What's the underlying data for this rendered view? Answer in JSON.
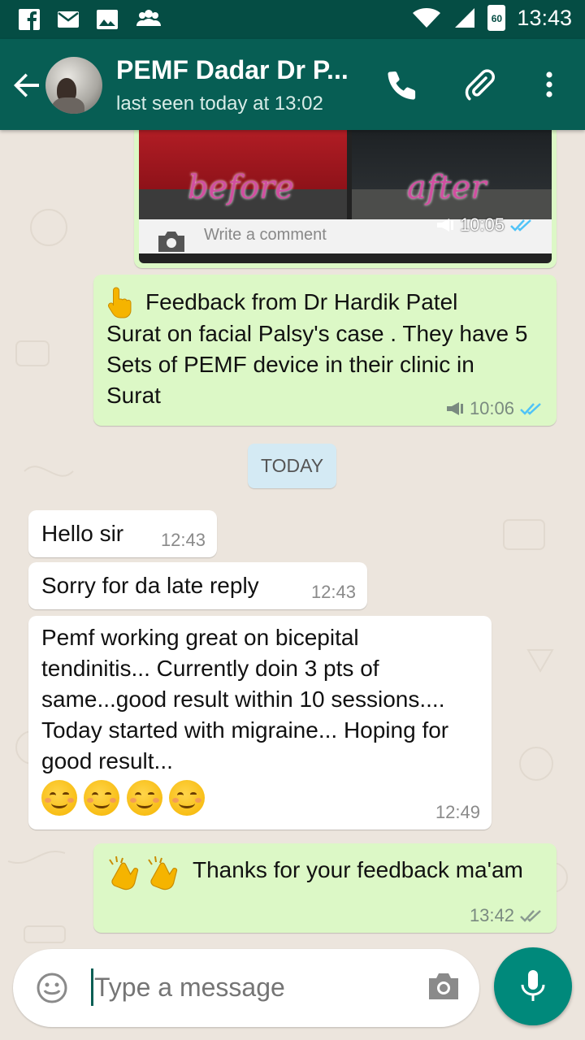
{
  "status_bar": {
    "time": "13:43",
    "battery_level": "60",
    "icons": [
      "facebook-icon",
      "mail-icon",
      "image-icon",
      "people-icon",
      "wifi-icon",
      "signal-icon",
      "battery-icon"
    ]
  },
  "header": {
    "contact_name": "PEMF Dadar Dr P...",
    "status": "last seen today at 13:02",
    "icons": [
      "back-arrow-icon",
      "phone-icon",
      "paperclip-icon",
      "more-vert-icon"
    ]
  },
  "messages": [
    {
      "type": "image",
      "direction": "outgoing",
      "labels": [
        "before",
        "after"
      ],
      "comment_placeholder": "Write a comment",
      "time": "10:05",
      "status": "read"
    },
    {
      "type": "text",
      "direction": "outgoing",
      "line1": "Feedback from Dr Hardik Patel",
      "text": "Surat on facial Palsy's case . They have 5 Sets of PEMF device in their clinic in Surat",
      "emoji": "pointing-up-icon",
      "time": "10:06",
      "status": "read"
    },
    {
      "type": "date",
      "text": "TODAY"
    },
    {
      "type": "text",
      "direction": "incoming",
      "text": "Hello sir",
      "time": "12:43"
    },
    {
      "type": "text",
      "direction": "incoming",
      "text": "Sorry for da late reply",
      "time": "12:43"
    },
    {
      "type": "text",
      "direction": "incoming",
      "text": "Pemf working great on bicepital tendinitis... Currently doin 3 pts of same...good result within 10 sessions.... Today started with migraine... Hoping for good result...",
      "emoji_count": 4,
      "time": "12:49"
    },
    {
      "type": "text",
      "direction": "outgoing",
      "text": "Thanks for your feedback ma'am",
      "emoji_count": 2,
      "time": "13:42",
      "status": "delivered"
    }
  ],
  "input": {
    "placeholder": "Type a message",
    "icons": [
      "emoji-icon",
      "camera-icon",
      "mic-icon"
    ]
  },
  "colors": {
    "status_bar": "#054D44",
    "app_bar": "#075E54",
    "outgoing_bubble": "#DCF8C6",
    "incoming_bubble": "#FFFFFF",
    "chat_background": "#ECE5DD",
    "date_chip": "#D4EAF4",
    "read_ticks": "#4FC3F7",
    "fab": "#00897B"
  }
}
